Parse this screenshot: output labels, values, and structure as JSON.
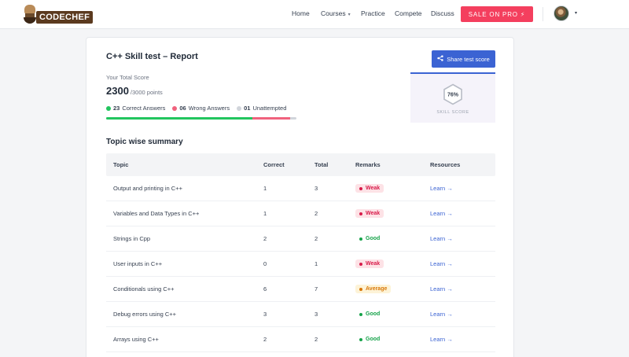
{
  "nav": {
    "logo_text": "CODECHEF",
    "links": [
      {
        "label": "Home",
        "has_dropdown": false
      },
      {
        "label": "Courses",
        "has_dropdown": true
      },
      {
        "label": "Practice",
        "has_dropdown": false
      },
      {
        "label": "Compete",
        "has_dropdown": false
      },
      {
        "label": "Discuss",
        "has_dropdown": false
      }
    ],
    "sale_label": "SALE ON PRO ⚡",
    "dropdown_caret": "▾"
  },
  "report": {
    "title": "C++ Skill test – Report",
    "share_label": "Share test score",
    "share_icon": "share-icon",
    "total_label": "Your Total Score",
    "score": "2300",
    "score_max": "/3000 points",
    "correct_count": "23",
    "correct_label": "Correct Answers",
    "wrong_count": "06",
    "wrong_label": "Wrong Answers",
    "unattempted_count": "01",
    "unattempted_label": "Unattempted",
    "progress": {
      "correct_fraction": 0.7667,
      "wrong_fraction": 0.2,
      "unattempted_fraction": 0.0333
    },
    "skill_score": "76%",
    "skill_label": "SKILL SCORE"
  },
  "topics": {
    "title": "Topic wise summary",
    "headers": {
      "topic": "Topic",
      "correct": "Correct",
      "total": "Total",
      "remarks": "Remarks",
      "resources": "Resources"
    },
    "rows": [
      {
        "topic": "Output and printing in C++",
        "correct": "1",
        "total": "3",
        "remark": "Weak",
        "remark_type": "weak",
        "resource": "Learn →"
      },
      {
        "topic": "Variables and Data Types in C++",
        "correct": "1",
        "total": "2",
        "remark": "Weak",
        "remark_type": "weak",
        "resource": "Learn →"
      },
      {
        "topic": "Strings in Cpp",
        "correct": "2",
        "total": "2",
        "remark": "Good",
        "remark_type": "good",
        "resource": "Learn →"
      },
      {
        "topic": "User inputs in C++",
        "correct": "0",
        "total": "1",
        "remark": "Weak",
        "remark_type": "weak",
        "resource": "Learn →"
      },
      {
        "topic": "Conditionals using C++",
        "correct": "6",
        "total": "7",
        "remark": "Average",
        "remark_type": "average",
        "resource": "Learn →"
      },
      {
        "topic": "Debug errors using C++",
        "correct": "3",
        "total": "3",
        "remark": "Good",
        "remark_type": "good",
        "resource": "Learn →"
      },
      {
        "topic": "Arrays using C++",
        "correct": "2",
        "total": "2",
        "remark": "Good",
        "remark_type": "good",
        "resource": "Learn →"
      }
    ]
  },
  "colors": {
    "correct": "#22c55e",
    "wrong": "#f0627d",
    "unattempted": "#d1d5db",
    "accent": "#3b63d3",
    "sale": "#f43f5e"
  }
}
